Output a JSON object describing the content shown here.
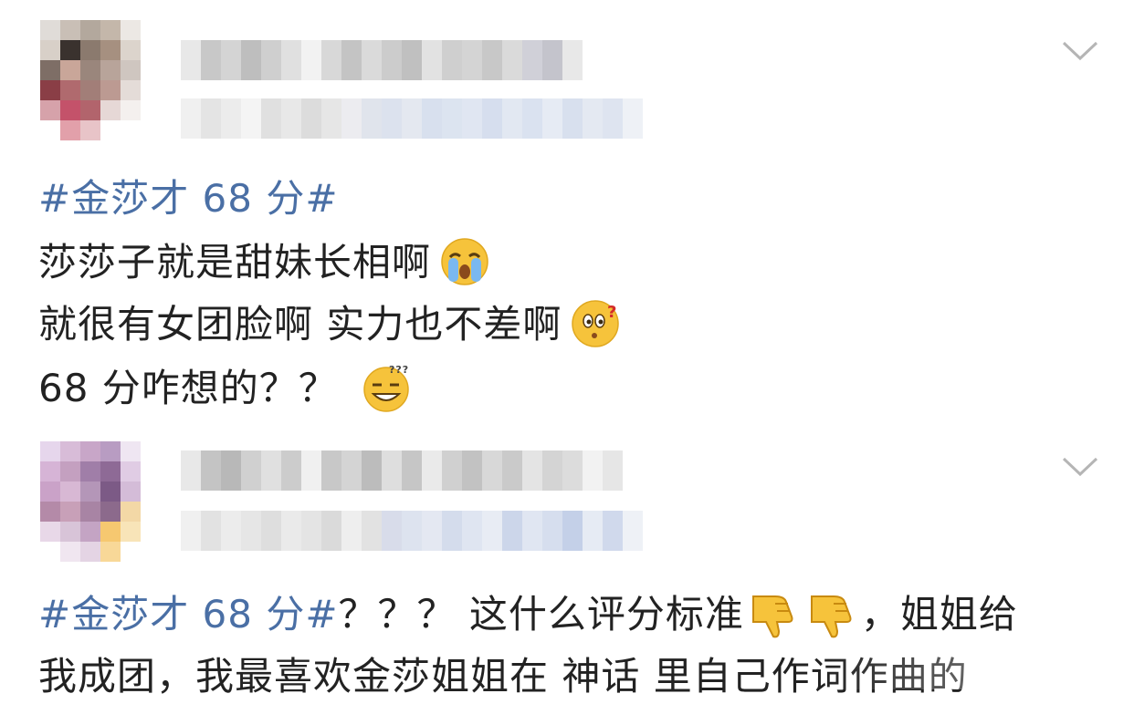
{
  "post1": {
    "hashtag": "#金莎才 68 分#",
    "line1": "莎莎子就是甜妹长相啊",
    "line2": "就很有女团脸啊 实力也不差啊",
    "line3": "68 分咋想的？？",
    "emoji1": "crying-face-icon",
    "emoji2": "confused-face-icon",
    "emoji3": "thinking-smile-icon"
  },
  "post2": {
    "hashtag": "#金莎才 68 分#",
    "line1_rest": "？？？ 这什么评分标准",
    "line1_after": "，姐姐给",
    "line2": "我成团，我最喜欢金莎姐姐在 神话 里自己作词作曲的",
    "emoji": "thumbs-down-icon"
  },
  "colors": {
    "hashtag": "#4a6fa5",
    "text": "#222222",
    "chevron": "#b5b5b5"
  }
}
